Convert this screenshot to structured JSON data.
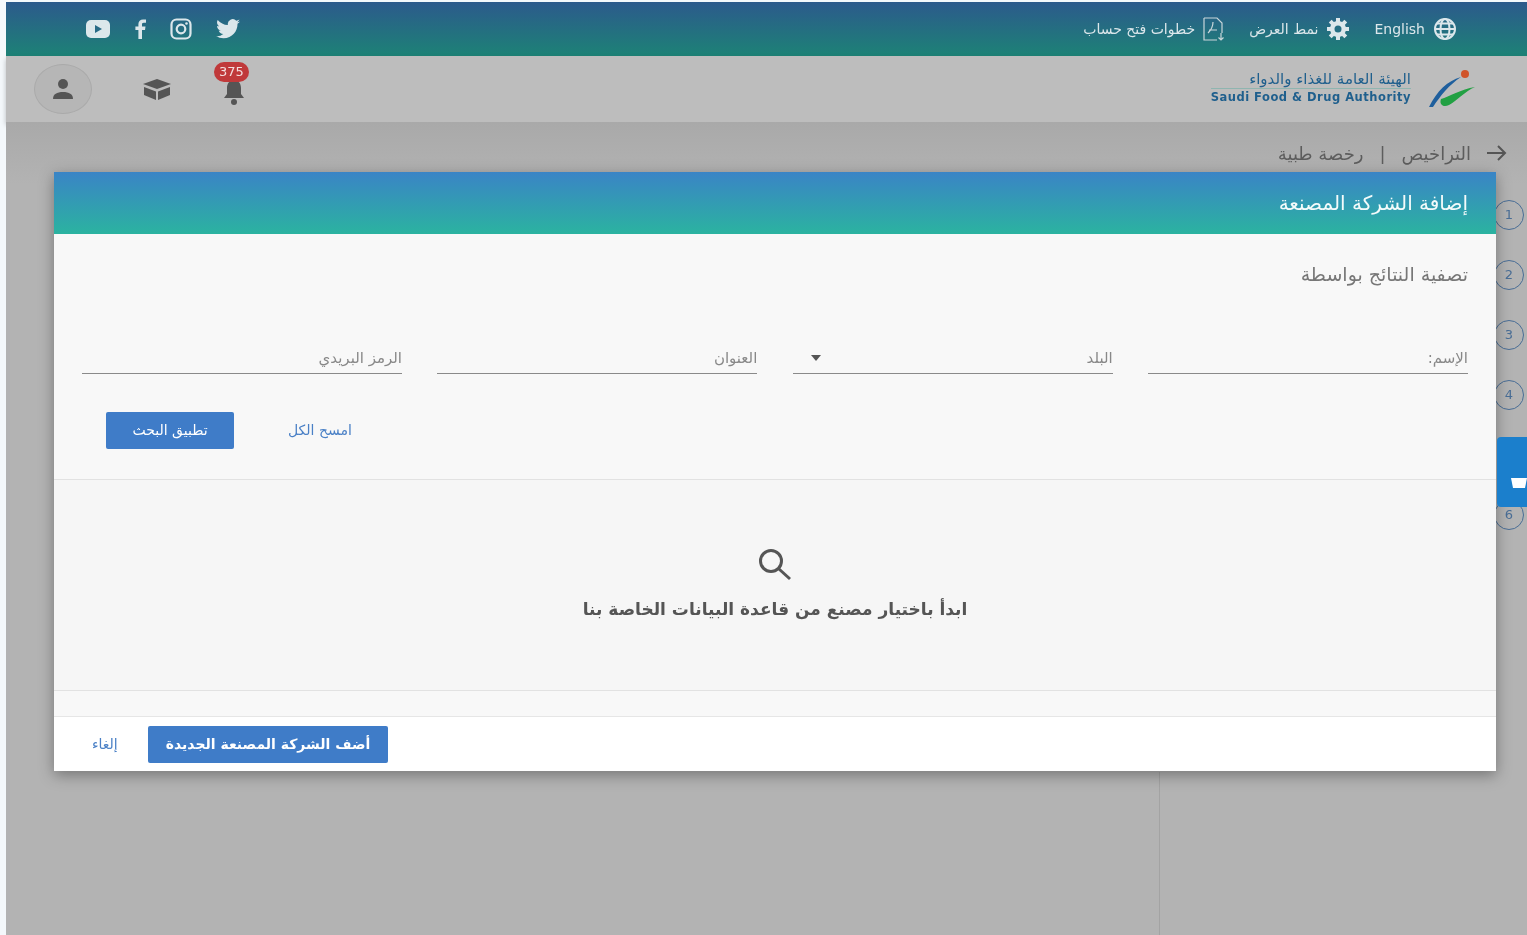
{
  "top_bar": {
    "language": "English",
    "display_mode": "نمط العرض",
    "account_steps": "خطوات فتح حساب"
  },
  "header": {
    "logo_title": "الهيئة العامة للغذاء والدواء",
    "logo_subtitle": "Saudi Food & Drug Authority",
    "notification_count": "375"
  },
  "breadcrumb": {
    "separator": "|",
    "items": [
      "التراخيص",
      "رخصة طبية"
    ]
  },
  "steps": [
    {
      "label": "1"
    },
    {
      "label": "2"
    },
    {
      "label": "3"
    },
    {
      "label": "4"
    },
    {
      "label": "6"
    }
  ],
  "modal": {
    "title": "إضافة الشركة المصنعة",
    "filter_heading": "تصفية النتائج بواسطة",
    "fields": [
      {
        "kind": "text",
        "placeholder": "الإسم:"
      },
      {
        "kind": "select",
        "placeholder": "البلد"
      },
      {
        "kind": "text",
        "placeholder": "العنوان"
      },
      {
        "kind": "text",
        "placeholder": "الرمز البريدي"
      }
    ],
    "clear_all": "امسح الكل",
    "apply_search": "تطبيق البحث",
    "empty_message": "ابدأ باختيار مصنع من قاعدة البيانات الخاصة بنا",
    "add_new": "أضف الشركة المصنعة الجديدة",
    "cancel": "إلغاء"
  }
}
